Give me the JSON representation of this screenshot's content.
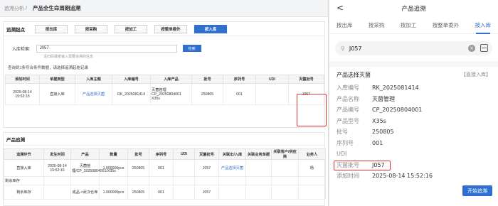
{
  "desktop": {
    "breadcrumb": "追溯分析 /",
    "page_title": "产品全生命周期追溯",
    "trace_section": {
      "label": "追溯起点",
      "buttons": [
        "按出库",
        "按采购",
        "按加工",
        "按整单委外",
        "按入库"
      ],
      "active_index": 4
    },
    "search": {
      "label": "入库检索:",
      "value": "J057",
      "hint": "请扫码或者输入需要追溯的信息",
      "button": "检索"
    },
    "match_note": "查询到1条符合条件数据，请选择追溯起始记录",
    "top_table": {
      "headers": [
        "添加时间",
        "单据类型",
        "入库主题",
        "入库编号",
        "入库产品",
        "批号",
        "序列号",
        "UDI",
        "灭菌批号"
      ],
      "rows": [
        [
          "2025-08-14 15:52:15",
          "直接入库",
          "产品选择灭菌",
          "RK_2025081414",
          "灭菌管理 CP_20250804001 X35s",
          "250805",
          "001",
          "",
          "J057"
        ]
      ]
    },
    "trace_panel": {
      "title": "产品追溯",
      "headers": [
        "追溯环节",
        "发生时间",
        "产品",
        "数量",
        "批号",
        "序列号",
        "UDI",
        "灭菌批号",
        "关联出/入库",
        "关联业务单据",
        "关联客户/供应商",
        "业务人"
      ],
      "rows": [
        [
          "直接入库",
          "2025-08-14 15:52:16",
          "灭菌管理/CP_20250804001/X35s",
          "1.000000pcs",
          "250805",
          "001",
          "",
          "J057",
          "产品选择灭菌",
          "",
          "",
          "杨"
        ],
        [
          "剩余库存",
          "",
          "",
          "",
          "",
          "",
          "",
          "",
          "",
          "",
          "",
          ""
        ],
        [
          "剩余库存",
          "",
          "成品->武汉仓库",
          "1.000000pcs",
          "250805",
          "001",
          "",
          "J057",
          "",
          "",
          "",
          ""
        ]
      ]
    }
  },
  "mobile": {
    "title": "产品追溯",
    "back": "<",
    "tabs": [
      "按出库",
      "按采购",
      "按加工",
      "按整单委外",
      "按入库"
    ],
    "active_tab": 4,
    "search_value": "J057",
    "section_title": "产品选择灭菌",
    "section_tag": "【直接入库】",
    "fields": [
      {
        "k": "入库编号",
        "v": "RK_2025081414"
      },
      {
        "k": "产品名称",
        "v": "灭菌管理"
      },
      {
        "k": "产品编号",
        "v": "CP_20250804001"
      },
      {
        "k": "产品型号",
        "v": "X35s"
      },
      {
        "k": "批号",
        "v": "250805"
      },
      {
        "k": "序列号",
        "v": "001"
      },
      {
        "k": "UDI",
        "v": ""
      },
      {
        "k": "灭菌批号",
        "v": "J057"
      },
      {
        "k": "添加时间",
        "v": "2025-08-14 15:52:16"
      }
    ],
    "start_button": "开始追溯",
    "highlight_color": "#e03535",
    "accent_color": "#2f6fd1"
  }
}
